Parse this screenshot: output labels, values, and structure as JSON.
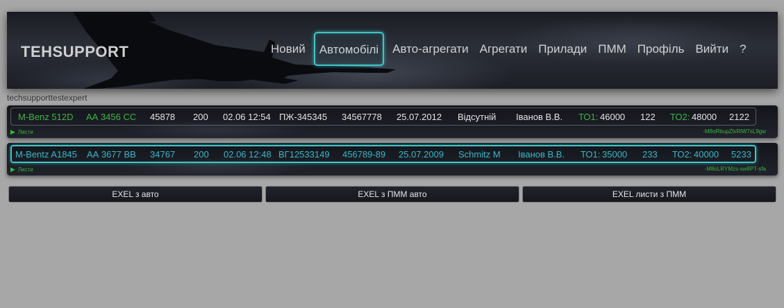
{
  "header": {
    "logo": "TEHSUPPORT",
    "nav": [
      "Новий",
      "Автомобілі",
      "Авто-агрегати",
      "Агрегати",
      "Прилади",
      "ПММ",
      "Профіль",
      "Вийти",
      "?"
    ],
    "active_index": 1
  },
  "user": "techsupporttestexpert",
  "vehicles": [
    {
      "model": "M-Benz 512D",
      "plate": "АА 3456 СС",
      "mileage": "45878",
      "value": "200",
      "datetime": "02.06 12:54",
      "number": "ПЖ-345345",
      "doc": "34567778",
      "date": "25.07.2012",
      "driver": "Відсутній",
      "owner": "Іванов В.В.",
      "to1_label": "ТО1:",
      "to1_value": "46000",
      "to1_extra": "122",
      "to2_label": "ТО2:",
      "to2_value": "48000",
      "to2_extra": "2122",
      "sheets_label": "Листи",
      "code": "-M8oRbupZlxRlW7sL9gw"
    },
    {
      "model": "M-Bentz A1845",
      "plate": "АА 3677 ВВ",
      "mileage": "34767",
      "value": "200",
      "datetime": "02.06 12:48",
      "number": "ВГ12533149",
      "doc": "456789-89",
      "date": "25.07.2009",
      "driver": "Schmitz M",
      "owner": "Іванов В.В.",
      "to1_label": "ТО1:",
      "to1_value": "35000",
      "to1_extra": "233",
      "to2_label": "ТО2:",
      "to2_value": "40000",
      "to2_extra": "5233",
      "sheets_label": "Листи",
      "code": "-M8oLRYMzs-sw8PT-sfa"
    }
  ],
  "buttons": [
    "EXEL з авто",
    "EXEL з ПММ авто",
    "EXEL листи з ПММ"
  ],
  "colors": {
    "accent": "#3fc6c8",
    "green": "#3db544",
    "cyan": "#36b8c8",
    "background": "#a7a7a7"
  }
}
